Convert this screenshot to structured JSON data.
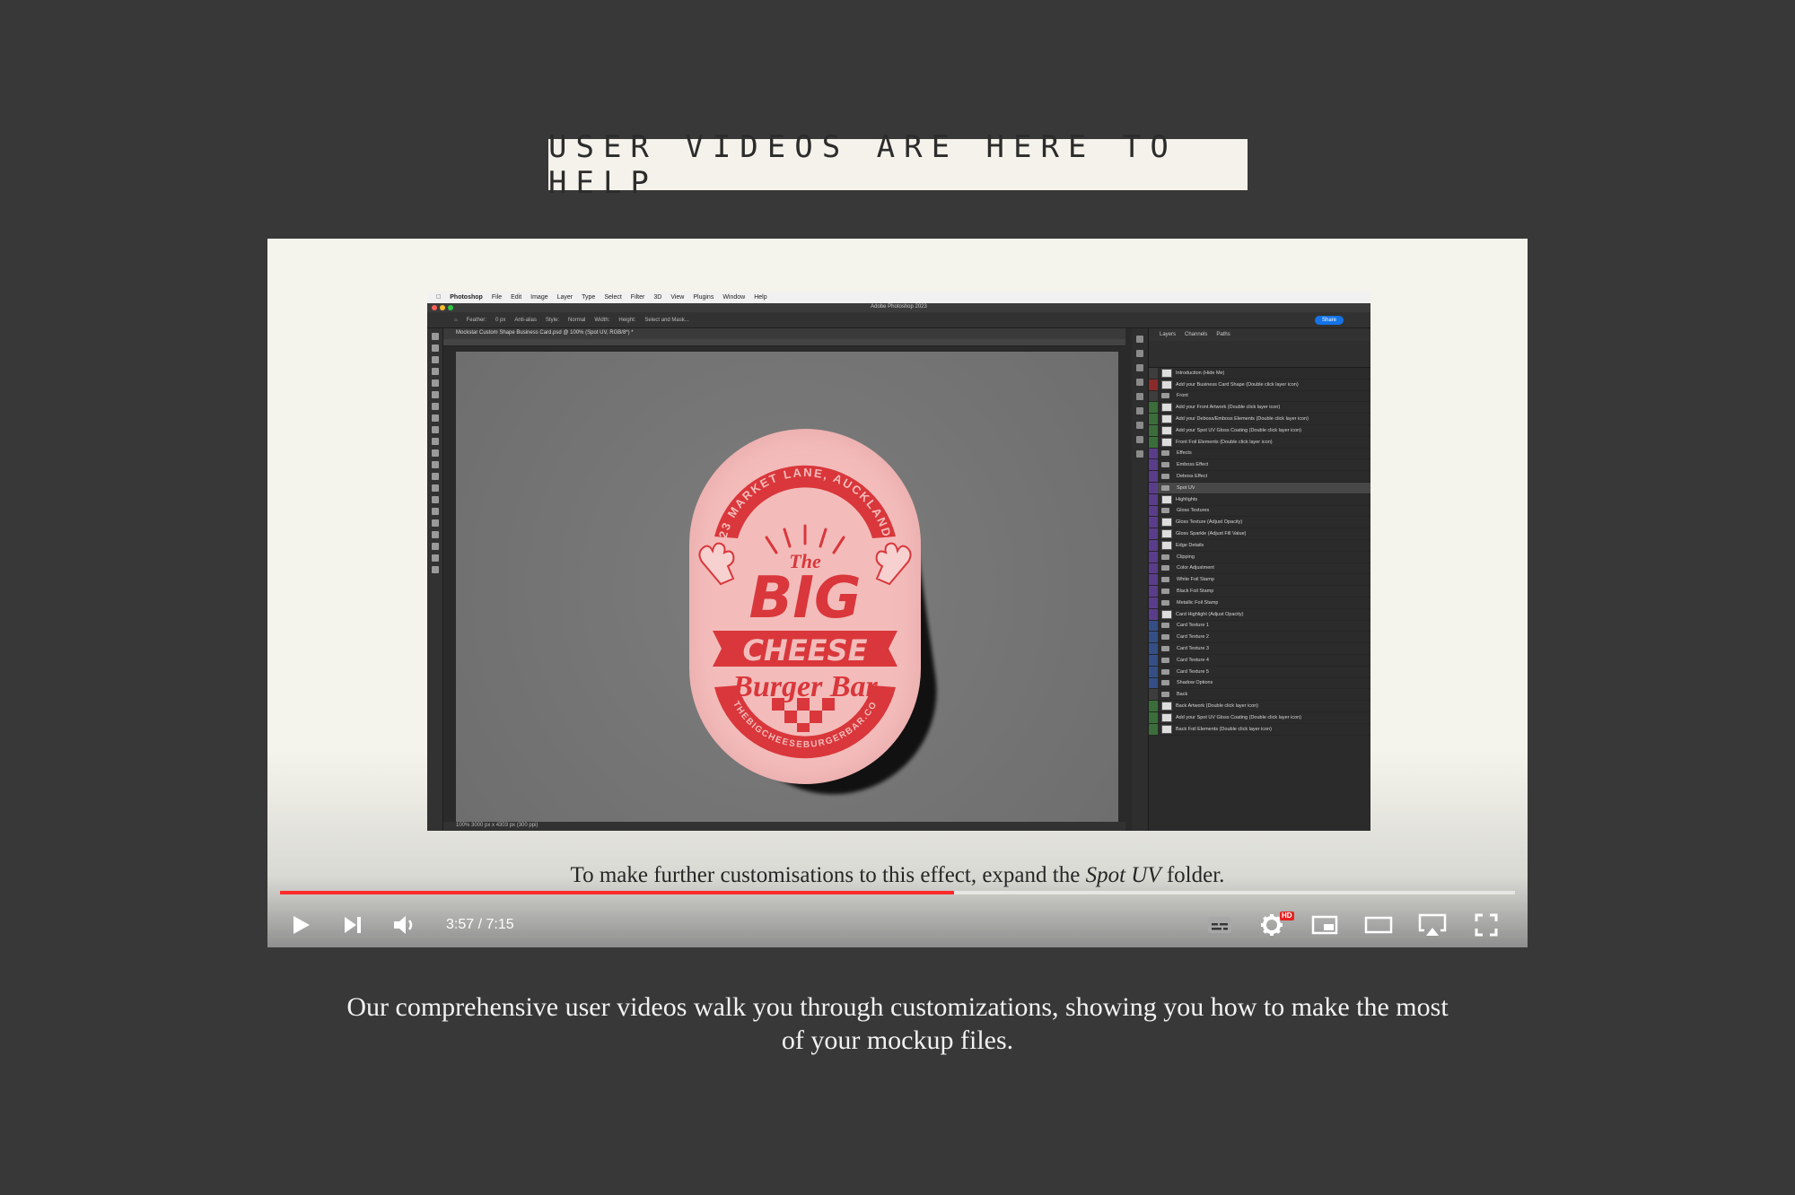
{
  "heading": "USER VIDEOS ARE HERE TO HELP",
  "photoshop": {
    "menu": [
      "Photoshop",
      "File",
      "Edit",
      "Image",
      "Layer",
      "Type",
      "Select",
      "Filter",
      "3D",
      "View",
      "Plugins",
      "Window",
      "Help"
    ],
    "window_title": "Adobe Photoshop 2023",
    "options": [
      "Feather:",
      "0 px",
      "Anti-alias",
      "Style:",
      "Normal",
      "Width:",
      "Height:",
      "Select and Mask..."
    ],
    "share_label": "Share",
    "document_tab": "Mockstar Custom Shape Business Card.psd @ 100% (Spot UV, RGB/8*) *",
    "status": "100%   3000 px x 4303 px (300 ppi)",
    "panel_tabs": [
      "Layers",
      "Channels",
      "Paths"
    ],
    "layers": [
      "Introduction (Hide Me)",
      "Add your Business Card Shape (Double click layer icon)",
      "Front",
      "Add your Front Artwork (Double click layer icon)",
      "Add your Deboss/Emboss Elements (Double click layer icon)",
      "Add your Spot UV Gloss Coating (Double click layer icon)",
      "Front Foil Elements (Double click layer icon)",
      "Effects",
      "Emboss Effect",
      "Deboss Effect",
      "Spot UV",
      "Highlights",
      "Gloss Textures",
      "Gloss Texture (Adjust Opacity)",
      "Gloss Sparkle (Adjust Fill Value)",
      "Edge Details",
      "Clipping",
      "Color Adjustment",
      "White Foil Stamp",
      "Black Foil Stamp",
      "Metallic Foil Stamp",
      "Card Highlight (Adjust Opacity)",
      "Card Texture 1",
      "Card Texture 2",
      "Card Texture 3",
      "Card Texture 4",
      "Card Texture 5",
      "Shadow Options",
      "Back",
      "Back Artwork (Double click layer icon)",
      "Add your Spot UV Gloss Coating (Double click layer icon)",
      "Back Foil Elements (Double click layer icon)"
    ],
    "card": {
      "top_arc": "23 MARKET LANE, AUCKLAND",
      "the": "The",
      "big": "BIG",
      "cheese": "CHEESE",
      "burger_bar": "Burger Bar",
      "bottom_arc": "THEBIGCHEESEBURGERBAR.CO"
    }
  },
  "video": {
    "caption_before": "To make further customisations to this effect, expand the ",
    "caption_italic": "Spot UV",
    "caption_after": " folder.",
    "time": "3:57 / 7:15",
    "progress": 0.546,
    "hd": "HD"
  },
  "description": "Our comprehensive user videos walk you through customizations, showing you how to make the most of your mockup files.",
  "colors": {
    "background": "#383838",
    "progress": "#ff2b2b",
    "card_pink": "#f3bcbb",
    "card_red": "#d9373b"
  }
}
